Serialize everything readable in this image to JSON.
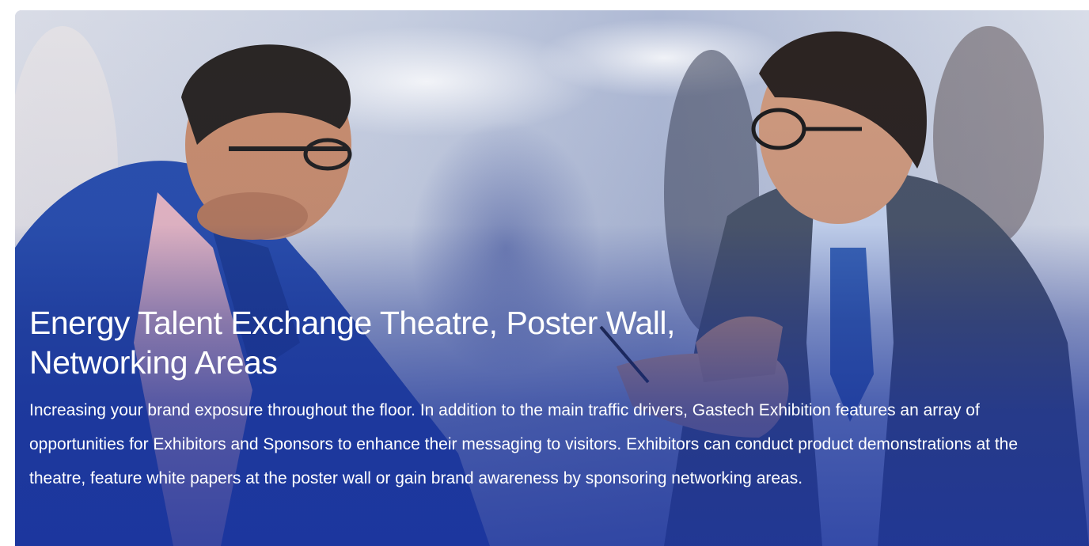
{
  "hero": {
    "title": "Energy Talent Exchange Theatre, Poster Wall, Networking Areas",
    "description": "Increasing your brand exposure throughout the floor. In addition to the main traffic drivers, Gastech Exhibition features an array of opportunities for Exhibitors and Sponsors to enhance their messaging to visitors. Exhibitors can conduct product demonstrations at the theatre, feature white papers at the poster wall or gain brand awareness by sponsoring networking areas.",
    "image_subject": "two men talking at an exhibition",
    "overlay_color": "#1e3296"
  }
}
